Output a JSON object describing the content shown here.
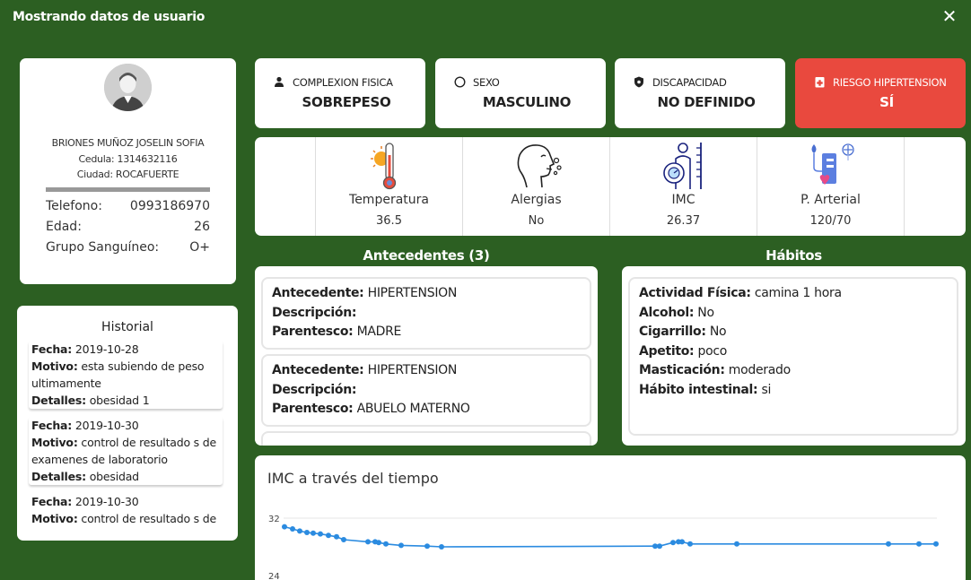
{
  "window": {
    "title": "Mostrando datos de usuario"
  },
  "profile": {
    "name": "BRIONES MUÑOZ JOSELIN SOFIA",
    "cedula": "Cedula: 1314632116",
    "ciudad": "Ciudad: ROCAFUERTE",
    "fields": [
      {
        "label": "Telefono:",
        "value": "0993186970"
      },
      {
        "label": "Edad:",
        "value": "26"
      },
      {
        "label": "Grupo Sanguíneo:",
        "value": "O+"
      }
    ]
  },
  "historial": {
    "title": "Historial",
    "entries": [
      {
        "fecha_label": "Fecha:",
        "fecha": "2019-10-28",
        "motivo_label": "Motivo:",
        "motivo": "esta subiendo de peso ultimamente",
        "detalles_label": "Detalles:",
        "detalles": "obesidad 1"
      },
      {
        "fecha_label": "Fecha:",
        "fecha": "2019-10-30",
        "motivo_label": "Motivo:",
        "motivo": "control de resultado s de examenes de laboratorio",
        "detalles_label": "Detalles:",
        "detalles": "obesidad"
      },
      {
        "fecha_label": "Fecha:",
        "fecha": "2019-10-30",
        "motivo_label": "Motivo:",
        "motivo": "control de resultado s de"
      }
    ]
  },
  "info_cards": [
    {
      "label": "COMPLEXION FISICA",
      "value": "SOBREPESO",
      "icon": "person-icon"
    },
    {
      "label": "SEXO",
      "value": "MASCULINO",
      "icon": "circle-icon"
    },
    {
      "label": "DISCAPACIDAD",
      "value": "NO DEFINIDO",
      "icon": "shield-icon"
    },
    {
      "label": "RIESGO HIPERTENSION",
      "value": "SÍ",
      "icon": "medical-plus-icon",
      "color": "#e9493e"
    }
  ],
  "vitals": [
    {
      "label": "Temperatura",
      "value": "36.5"
    },
    {
      "label": "Alergias",
      "value": "No"
    },
    {
      "label": "IMC",
      "value": "26.37"
    },
    {
      "label": "P. Arterial",
      "value": "120/70"
    }
  ],
  "antecedentes": {
    "title": "Antecedentes (3)",
    "items": [
      {
        "ant_label": "Antecedente:",
        "ant": "HIPERTENSION",
        "desc_label": "Descripción:",
        "desc": "",
        "par_label": "Parentesco:",
        "par": "MADRE"
      },
      {
        "ant_label": "Antecedente:",
        "ant": "HIPERTENSION",
        "desc_label": "Descripción:",
        "desc": "",
        "par_label": "Parentesco:",
        "par": "ABUELO MATERNO"
      }
    ]
  },
  "habitos": {
    "title": "Hábitos",
    "items": [
      {
        "label": "Actividad Física:",
        "value": "camina 1 hora"
      },
      {
        "label": "Alcohol:",
        "value": "No"
      },
      {
        "label": "Cigarrillo:",
        "value": "No"
      },
      {
        "label": "Apetito:",
        "value": "poco"
      },
      {
        "label": "Masticación:",
        "value": "moderado"
      },
      {
        "label": "Hábito intestinal:",
        "value": "si"
      }
    ]
  },
  "chart_data": {
    "type": "line",
    "title": "IMC a través del tiempo",
    "ytick_labels": [
      "32",
      "24"
    ],
    "ylim": [
      24,
      32
    ],
    "color": "#2b8be0",
    "values": [
      30.8,
      30.5,
      30.2,
      30.0,
      29.9,
      29.8,
      29.6,
      29.4,
      29.0,
      28.7,
      28.7,
      28.6,
      28.4,
      28.2,
      28.1,
      28.0,
      28.1,
      28.1,
      28.6,
      28.7,
      28.7,
      28.4,
      28.4,
      28.4,
      28.4,
      28.4
    ]
  }
}
